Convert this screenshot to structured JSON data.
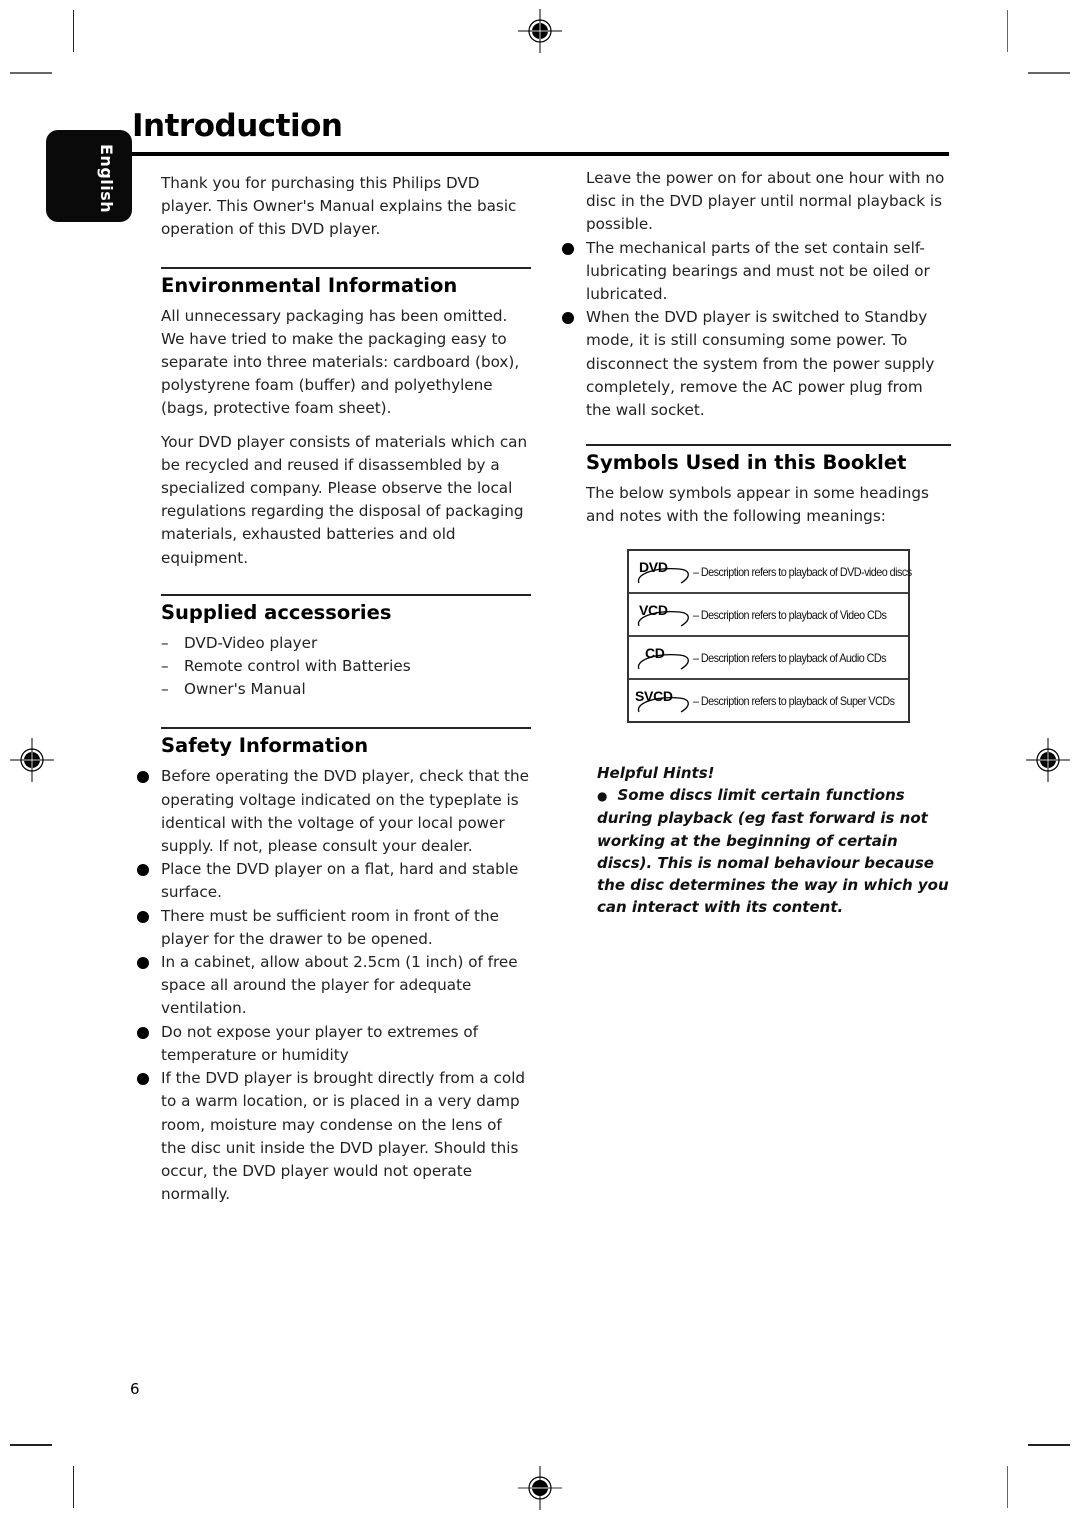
{
  "page": {
    "title": "Introduction",
    "language_tab": "English",
    "page_number": "6"
  },
  "intro": {
    "text": "Thank you for purchasing this Philips DVD player. This Owner's Manual explains the basic operation of this DVD player."
  },
  "environmental": {
    "heading": "Environmental Information",
    "paragraphs": [
      "All unnecessary packaging has been omitted. We have tried to make the packaging easy to separate into three materials: cardboard (box), polystyrene foam (buffer) and polyethylene (bags, protective foam sheet).",
      "Your DVD player consists of materials which can be recycled and reused if disassembled by a specialized company. Please observe the local regulations regarding the disposal of packaging materials, exhausted batteries and old equipment."
    ]
  },
  "accessories": {
    "heading": "Supplied accessories",
    "dash": "–",
    "items": [
      "DVD-Video player",
      "Remote control with Batteries",
      "Owner's Manual"
    ]
  },
  "safety": {
    "heading": "Safety Information",
    "items": [
      "Before operating the DVD player, check that the operating voltage indicated on the typeplate is identical with the voltage of your local power supply. If not, please consult your dealer.",
      "Place the DVD player on a flat, hard and stable surface.",
      "There must be sufficient room in front of the player for the drawer to be opened.",
      "In a cabinet, allow about 2.5cm (1 inch) of free space all around the player for adequate ventilation.",
      "Do not expose your player to extremes of temperature or humidity",
      "If the DVD player is brought directly from a cold to a warm location, or is placed in a very damp room, moisture may condense on the lens of the disc unit inside the DVD player. Should this occur, the DVD player would not operate normally."
    ],
    "continued_text": "Leave the power on for about one hour with no disc in the DVD player until normal playback is possible.",
    "more_items": [
      "The mechanical parts of the set contain self-lubricating bearings and must not be oiled or lubricated.",
      "When the DVD player is switched to Standby mode, it is still consuming some power. To disconnect the system from the power supply completely, remove the AC power plug from the wall socket."
    ]
  },
  "symbols": {
    "heading": "Symbols Used in this Booklet",
    "intro": "The below symbols appear in some headings and notes with the following meanings:",
    "rows": [
      {
        "badge": "DVD",
        "icon": "dvd-disc-icon",
        "description": "– Description refers to playback of DVD-video discs"
      },
      {
        "badge": "VCD",
        "icon": "vcd-disc-icon",
        "description": "– Description refers to playback of Video CDs"
      },
      {
        "badge": "CD",
        "icon": "cd-disc-icon",
        "description": "– Description refers to playback of Audio CDs"
      },
      {
        "badge": "SVCD",
        "icon": "svcd-disc-icon",
        "description": "– Description refers to playback of Super VCDs"
      }
    ]
  },
  "hints": {
    "title": "Helpful Hints!",
    "bullet": "●",
    "text": "Some discs limit certain functions during playback (eg fast forward is not working at the beginning of certain discs).   This is nomal behaviour because the disc determines the way in which you can interact with its content."
  }
}
